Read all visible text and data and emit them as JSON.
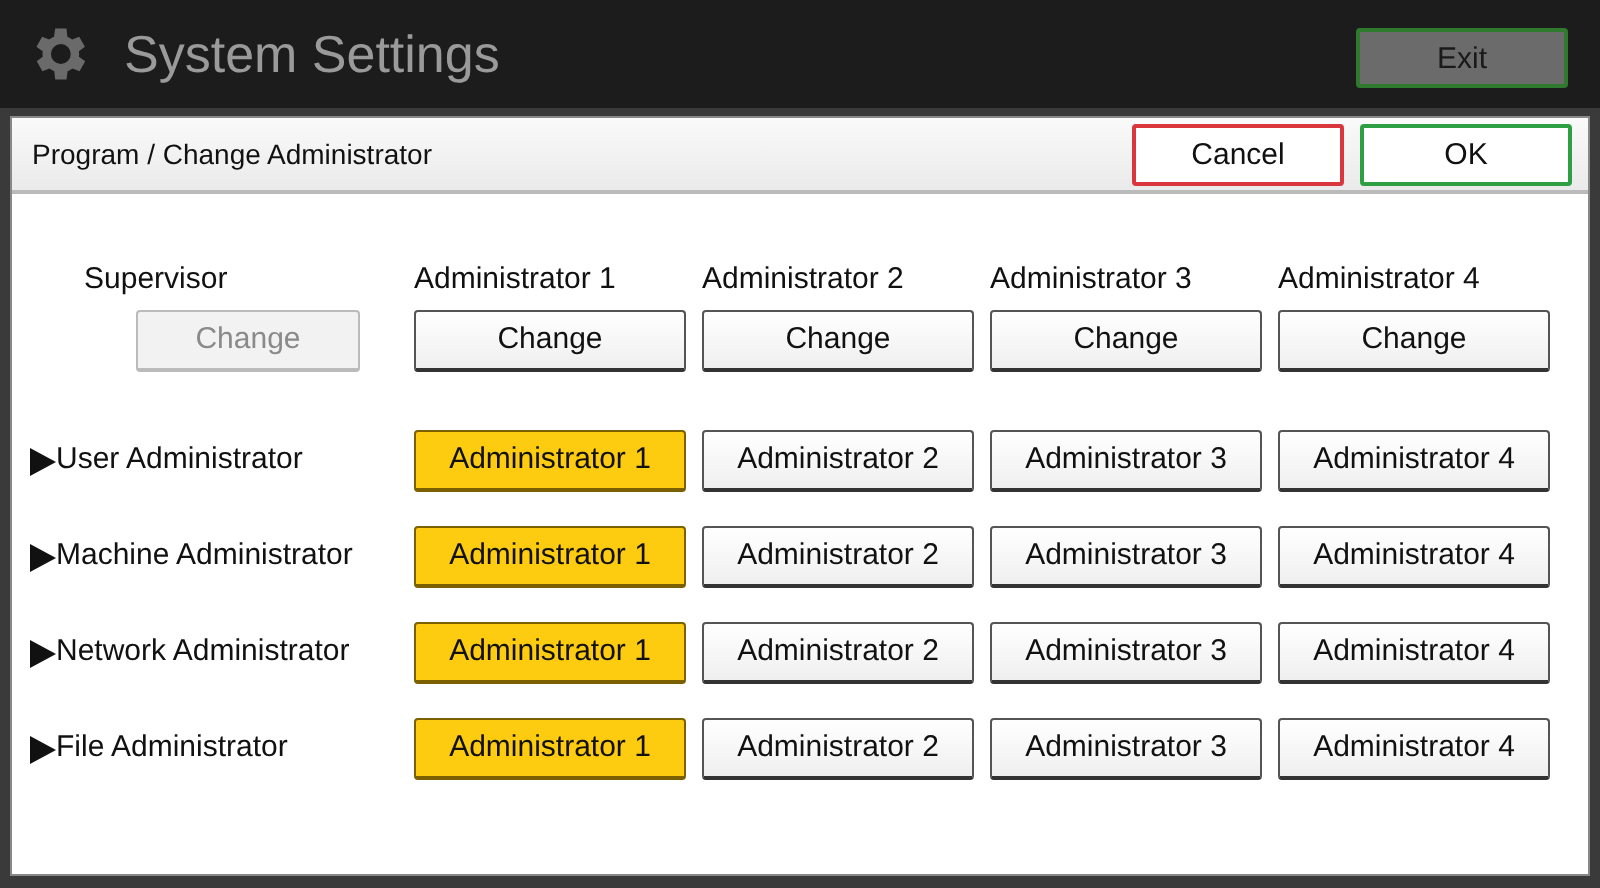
{
  "window": {
    "title": "System Settings",
    "exit_button": "Exit"
  },
  "dialog": {
    "title": "Program / Change Administrator",
    "cancel_button": "Cancel",
    "ok_button": "OK"
  },
  "columns": [
    {
      "label": "Supervisor",
      "button": "Change",
      "disabled": true
    },
    {
      "label": "Administrator 1",
      "button": "Change",
      "disabled": false
    },
    {
      "label": "Administrator 2",
      "button": "Change",
      "disabled": false
    },
    {
      "label": "Administrator 3",
      "button": "Change",
      "disabled": false
    },
    {
      "label": "Administrator 4",
      "button": "Change",
      "disabled": false
    }
  ],
  "rows": [
    {
      "label": "User Administrator",
      "options": [
        {
          "label": "Administrator 1",
          "selected": true
        },
        {
          "label": "Administrator 2",
          "selected": false
        },
        {
          "label": "Administrator 3",
          "selected": false
        },
        {
          "label": "Administrator 4",
          "selected": false
        }
      ]
    },
    {
      "label": "Machine Administrator",
      "options": [
        {
          "label": "Administrator 1",
          "selected": true
        },
        {
          "label": "Administrator 2",
          "selected": false
        },
        {
          "label": "Administrator 3",
          "selected": false
        },
        {
          "label": "Administrator 4",
          "selected": false
        }
      ]
    },
    {
      "label": "Network Administrator",
      "options": [
        {
          "label": "Administrator 1",
          "selected": true
        },
        {
          "label": "Administrator 2",
          "selected": false
        },
        {
          "label": "Administrator 3",
          "selected": false
        },
        {
          "label": "Administrator 4",
          "selected": false
        }
      ]
    },
    {
      "label": "File Administrator",
      "options": [
        {
          "label": "Administrator 1",
          "selected": true
        },
        {
          "label": "Administrator 2",
          "selected": false
        },
        {
          "label": "Administrator 3",
          "selected": false
        },
        {
          "label": "Administrator 4",
          "selected": false
        }
      ]
    }
  ]
}
